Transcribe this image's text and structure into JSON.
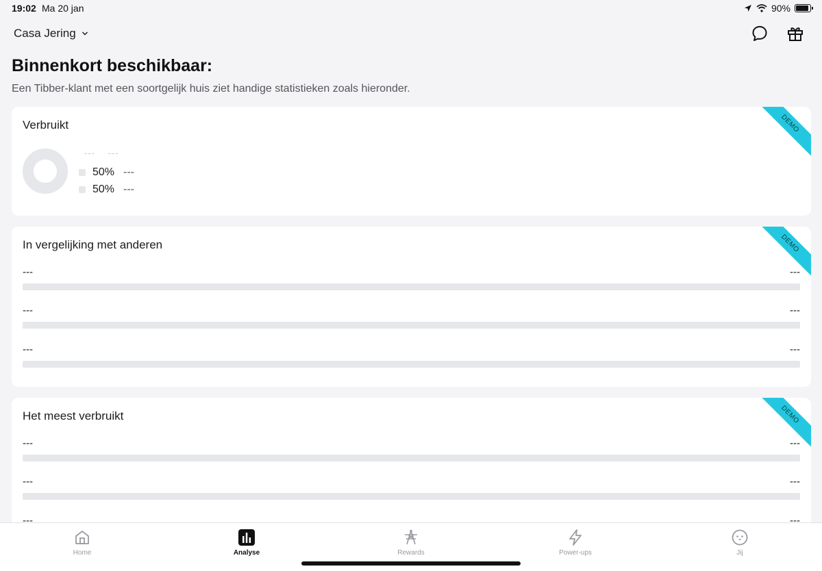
{
  "status_bar": {
    "time": "19:02",
    "date": "Ma 20 jan",
    "battery": "90%",
    "battery_level": 0.9
  },
  "header": {
    "home_name": "Casa Jering"
  },
  "intro": {
    "title": "Binnenkort beschikbaar:",
    "subtitle": "Een Tibber-klant met een soortgelijk huis ziet handige statistieken zoals hieronder."
  },
  "demo_label": "DEMO",
  "cards": {
    "usage": {
      "title": "Verbruikt",
      "legend_header": [
        "---",
        "---"
      ],
      "legend": [
        {
          "pct": "50%",
          "value": "---"
        },
        {
          "pct": "50%",
          "value": "---"
        }
      ]
    },
    "comparison": {
      "title": "In vergelijking met anderen",
      "rows": [
        {
          "left": "---",
          "right": "---"
        },
        {
          "left": "---",
          "right": "---"
        },
        {
          "left": "---",
          "right": "---"
        }
      ]
    },
    "most_used": {
      "title": "Het meest verbruikt",
      "rows": [
        {
          "left": "---",
          "right": "---"
        },
        {
          "left": "---",
          "right": "---"
        },
        {
          "left": "---",
          "right": "---"
        }
      ]
    }
  },
  "tabs": [
    {
      "label": "Home",
      "icon": "home-icon",
      "active": false
    },
    {
      "label": "Analyse",
      "icon": "analyse-icon",
      "active": true
    },
    {
      "label": "Rewards",
      "icon": "rewards-icon",
      "active": false
    },
    {
      "label": "Power-ups",
      "icon": "lightning-icon",
      "active": false
    },
    {
      "label": "Jij",
      "icon": "face-icon",
      "active": false
    }
  ],
  "colors": {
    "demo_ribbon": "#23c8e0",
    "placeholder": "#e5e7eb",
    "background": "#f4f4f6"
  }
}
